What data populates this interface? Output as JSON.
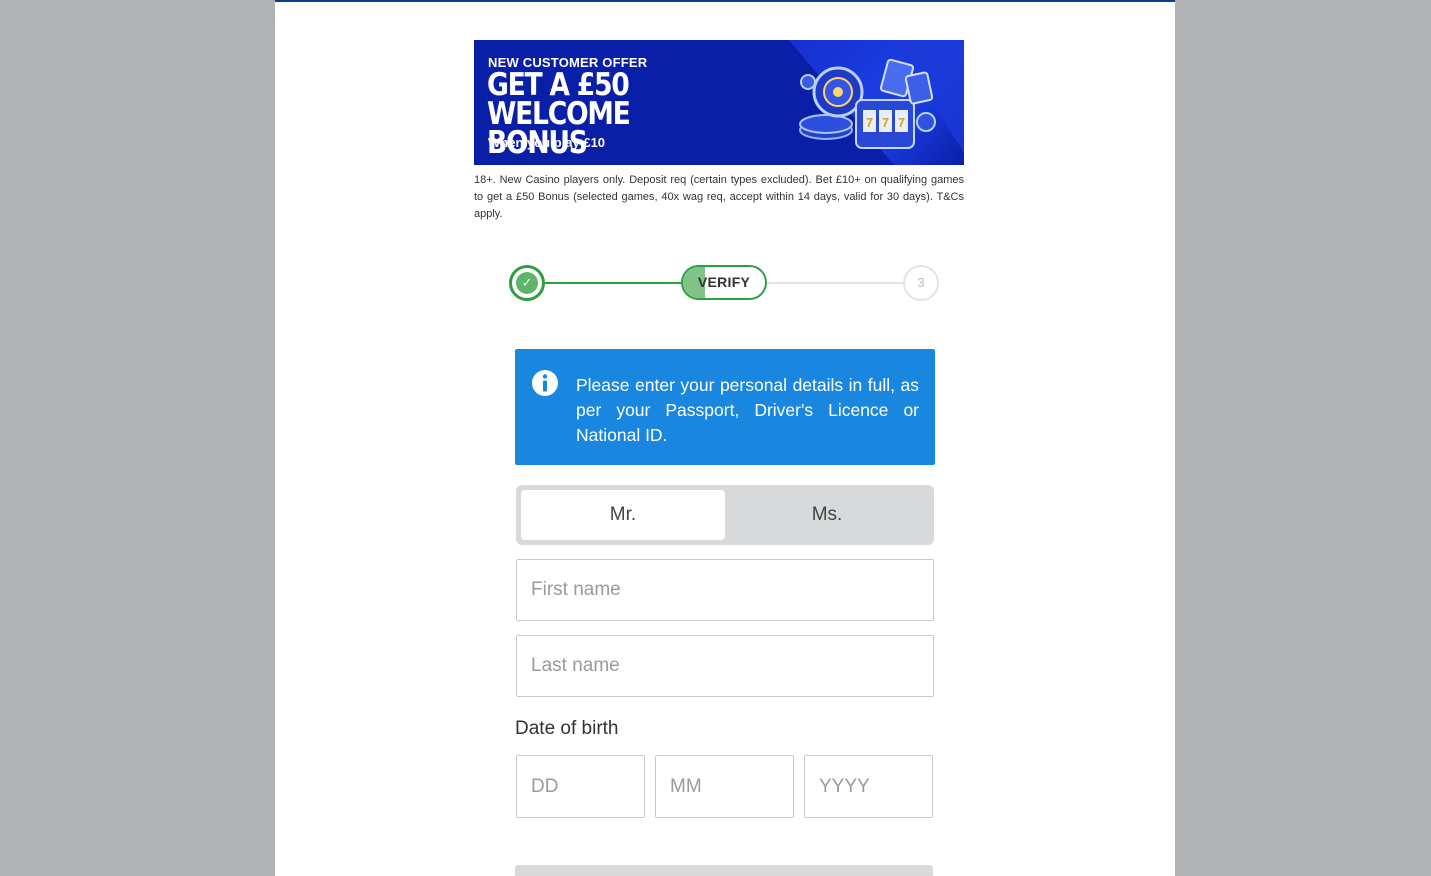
{
  "banner": {
    "offer_label": "NEW CUSTOMER OFFER",
    "headline_line1": "GET A £50",
    "headline_line2": "WELCOME BONUS",
    "subline": "When you play £10"
  },
  "disclaimer": "18+. New Casino players only. Deposit req (certain types excluded). Bet £10+ on qualifying games to get a £50 Bonus (selected games, 40x wag req, accept within 14 days, valid for 30 days). T&Cs apply.",
  "stepper": {
    "step1_icon": "check-icon",
    "step2_label": "VERIFY",
    "step3_label": "3"
  },
  "info": {
    "icon": "info-icon",
    "text": "Please enter your personal details in full, as per your Passport, Driver's Licence or National ID."
  },
  "title_toggle": {
    "options": [
      "Mr.",
      "Ms."
    ],
    "selected": "Mr."
  },
  "form": {
    "first_name_placeholder": "First name",
    "last_name_placeholder": "Last name",
    "dob_label": "Date of birth",
    "dd_placeholder": "DD",
    "mm_placeholder": "MM",
    "yyyy_placeholder": "YYYY"
  },
  "colors": {
    "banner_bg": "#0a1fa8",
    "success_green": "#2f9e3f",
    "info_blue": "#1987e0",
    "backdrop_grey": "#b1b2b4"
  }
}
